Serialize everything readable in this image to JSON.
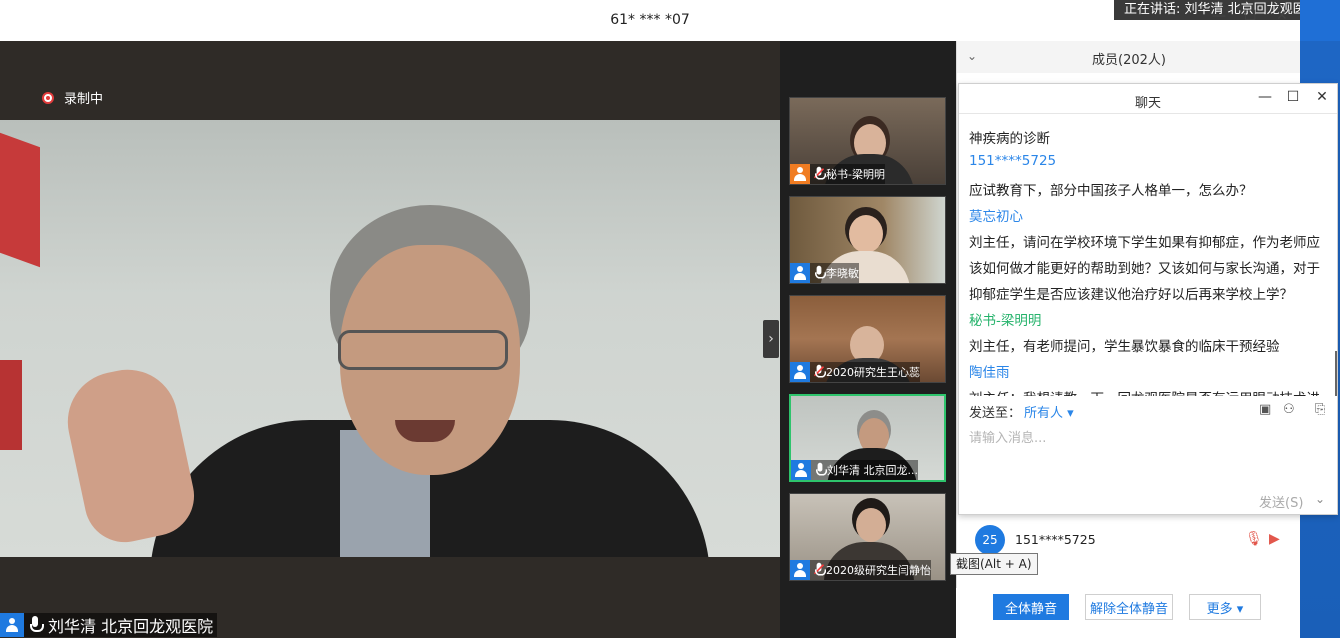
{
  "window": {
    "title": "61* *** *07",
    "speaking": "正在讲话: 刘华清 北京回龙观医...",
    "min_icon": "—",
    "max_icon": "☐",
    "close_icon": "✕"
  },
  "main_video": {
    "recording_label": "录制中",
    "speaker_name": "刘华清 北京回龙观医院"
  },
  "gallery": {
    "toggle_icon": "›",
    "thumbs": [
      {
        "name": "秘书-梁明明",
        "avatar_color": "#f07c22",
        "muted": true
      },
      {
        "name": "李晓敏",
        "avatar_color": "#1f7ae0",
        "muted": false
      },
      {
        "name": "2020研究生王心蕊",
        "avatar_color": "#1f7ae0",
        "muted": true
      },
      {
        "name": "刘华清 北京回龙...",
        "avatar_color": "#1f7ae0",
        "muted": false
      },
      {
        "name": "2020级研究生闫静怡",
        "avatar_color": "#1f7ae0",
        "muted": true
      }
    ]
  },
  "tooltip": "截图(Alt + A)",
  "members": {
    "title": "成员(202人)",
    "row": {
      "badge": "25",
      "name": "151****5725"
    }
  },
  "chat": {
    "title": "聊天",
    "lines": [
      {
        "text": "神疾病的诊断",
        "kind": "msg"
      },
      {
        "text": "151****5725",
        "kind": "sender"
      },
      {
        "text": "应试教育下，部分中国孩子人格单一，怎么办？",
        "kind": "msg"
      },
      {
        "text": "莫忘初心",
        "kind": "sender"
      },
      {
        "text": "刘主任，请问在学校环境下学生如果有抑郁症，作为老师应",
        "kind": "msg"
      },
      {
        "text": "该如何做才能更好的帮助到她？又该如何与家长沟通，对于",
        "kind": "msg"
      },
      {
        "text": "抑郁症学生是否应该建议他治疗好以后再来学校上学？",
        "kind": "msg"
      },
      {
        "text": "秘书-梁明明",
        "kind": "sender-green"
      },
      {
        "text": "刘主任，有老师提问，学生暴饮暴食的临床干预经验",
        "kind": "msg"
      },
      {
        "text": "陶佳雨",
        "kind": "sender"
      },
      {
        "text": "刘主任：我想请教一下，回龙观医院是否有运用眼动技术进",
        "kind": "msg"
      }
    ],
    "send_to_label": "发送至：",
    "send_to_value": "所有人 ▾",
    "input_placeholder": "请输入消息...",
    "send_label": "发送(S)"
  },
  "bottom": {
    "mute_all": "全体静音",
    "unmute_all": "解除全体静音",
    "more": "更多 ▾"
  },
  "colors": {
    "accent": "#1f7ae0",
    "active_border": "#2ec46c",
    "recording": "#e23c3c"
  }
}
